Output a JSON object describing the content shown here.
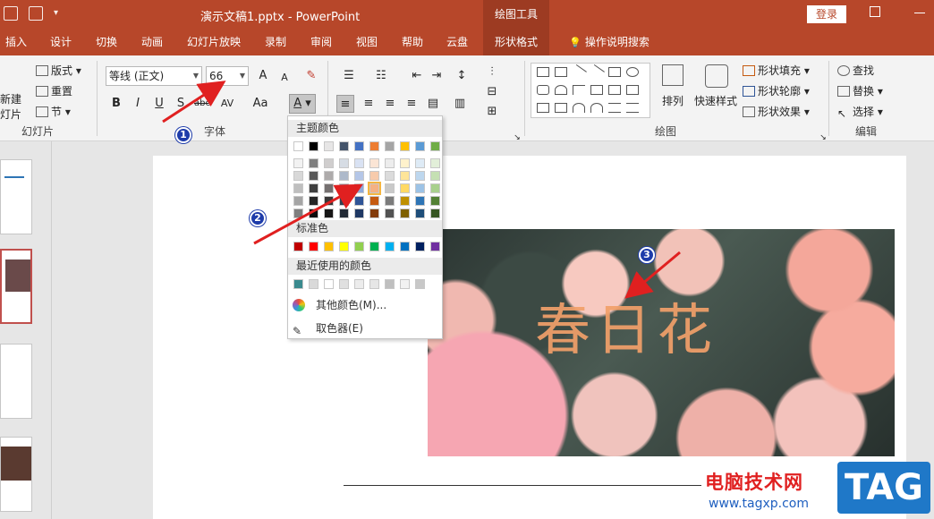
{
  "title_bar": {
    "document_title": "演示文稿1.pptx  -  PowerPoint",
    "context_tab": "绘图工具",
    "login_button": "登录"
  },
  "tabs": [
    {
      "label": "插入"
    },
    {
      "label": "设计"
    },
    {
      "label": "切换"
    },
    {
      "label": "动画"
    },
    {
      "label": "幻灯片放映"
    },
    {
      "label": "录制"
    },
    {
      "label": "审阅"
    },
    {
      "label": "视图"
    },
    {
      "label": "帮助"
    },
    {
      "label": "云盘"
    },
    {
      "label": "形状格式"
    },
    {
      "label": "操作说明搜索"
    }
  ],
  "ribbon": {
    "slides": {
      "new_slide_1": "新建",
      "new_slide_2": "灯片",
      "layout": "版式",
      "reset": "重置",
      "section": "节",
      "group_label": "幻灯片"
    },
    "font": {
      "font_name": "等线 (正文)",
      "font_size": "66",
      "group_label": "字体",
      "bold": "B",
      "italic": "I",
      "underline": "U",
      "strike": "S",
      "grow": "A",
      "shrink": "A",
      "case": "Aa",
      "font_color": "A"
    },
    "drawing": {
      "arrange": "排列",
      "quick_styles": "快速样式",
      "shape_fill": "形状填充",
      "shape_outline": "形状轮廓",
      "shape_effects": "形状效果",
      "group_label": "绘图"
    },
    "editing": {
      "find": "查找",
      "replace": "替换",
      "select": "选择",
      "group_label": "编辑"
    }
  },
  "color_menu": {
    "theme_colors_title": "主题颜色",
    "standard_colors_title": "标准色",
    "recent_colors_title": "最近使用的颜色",
    "more_colors": "其他颜色(M)...",
    "eyedropper": "取色器(E)",
    "theme_top": [
      "#ffffff",
      "#000000",
      "#e7e6e6",
      "#44546a",
      "#4472c4",
      "#ed7d31",
      "#a5a5a5",
      "#ffc000",
      "#5b9bd5",
      "#70ad47"
    ],
    "theme_shades": [
      [
        "#f2f2f2",
        "#7f7f7f",
        "#d0cece",
        "#d6dce4",
        "#d9e2f3",
        "#fbe5d5",
        "#ededed",
        "#fff2cc",
        "#deebf6",
        "#e2efd9"
      ],
      [
        "#d8d8d8",
        "#595959",
        "#aeabab",
        "#adb9ca",
        "#b4c6e7",
        "#f7cbac",
        "#dbdbdb",
        "#fee599",
        "#bdd7ee",
        "#c5e0b3"
      ],
      [
        "#bfbfbf",
        "#3f3f3f",
        "#757070",
        "#8496b0",
        "#8eaadb",
        "#f4b183",
        "#c9c9c9",
        "#ffd965",
        "#9dc3e6",
        "#a8d08d"
      ],
      [
        "#a5a5a5",
        "#262626",
        "#3a3838",
        "#323f4f",
        "#2f5496",
        "#c55a11",
        "#7b7b7b",
        "#bf9000",
        "#2e75b5",
        "#538135"
      ],
      [
        "#7f7f7f",
        "#0c0c0c",
        "#171616",
        "#222a35",
        "#1f3864",
        "#833c0b",
        "#525252",
        "#7f6000",
        "#1e4e79",
        "#375623"
      ]
    ],
    "standard": [
      "#c00000",
      "#ff0000",
      "#ffc000",
      "#ffff00",
      "#92d050",
      "#00b050",
      "#00b0f0",
      "#0070c0",
      "#002060",
      "#7030a0"
    ],
    "recent": [
      "#3a8a8e",
      "#d9d9d9",
      "#ffffff",
      "#e0e0e0",
      "#ececec",
      "#e6e6e6",
      "#bfbfbf",
      "#f2f2f2",
      "#c8c8c8"
    ]
  },
  "slide": {
    "image_text": "春日花"
  },
  "annotations": [
    "1",
    "2",
    "3"
  ],
  "watermark": {
    "site_name": "电脑技术网",
    "url": "www.tagxp.com",
    "tag": "TAG"
  }
}
